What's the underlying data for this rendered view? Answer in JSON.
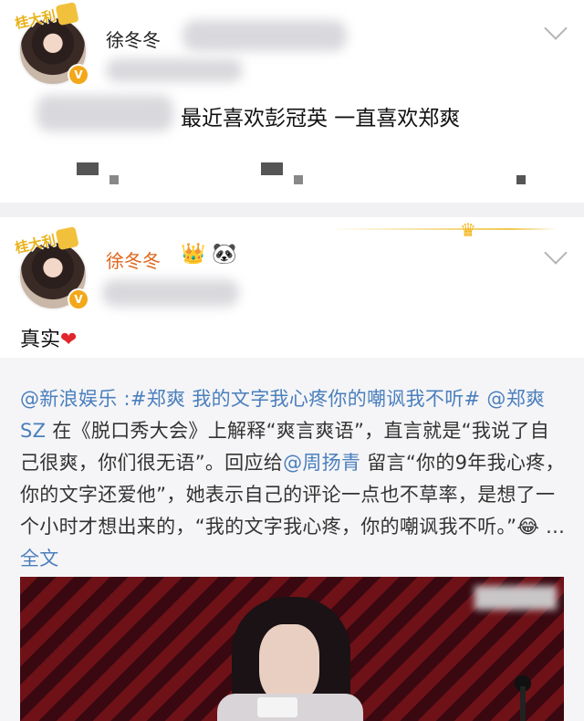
{
  "post1": {
    "username": "徐冬冬",
    "avatar_tag": "桂大利",
    "verified_glyph": "V",
    "content": "最近喜欢彭冠英 一直喜欢郑爽"
  },
  "post2": {
    "username": "徐冬冬",
    "crown_glyph": "👑",
    "panda_glyph": "🐼",
    "avatar_tag": "桂大利",
    "verified_glyph": "V",
    "content": "真实",
    "heart_glyph": "❤",
    "repost": {
      "mention_source": "@新浪娱乐",
      "sep": " :",
      "hashtag": "#郑爽 我的文字我心疼你的嘲讽我不听#",
      "space": " ",
      "mention_person": "@郑爽SZ",
      "text_1": " 在《脱口秀大会》上解释“爽言爽语”，直言就是“我说了自己很爽，你们很无语”。回应给",
      "mention_reply": "@周扬青",
      "text_2": " 留言“你的9年我心疼，你的文字还爱他”，她表示自己的评论一点也不草率，是想了一个小时才想出来的，“我的文字我心疼，你的嘲讽我不听。”",
      "emoji_glyph": "😂",
      "ellipsis": " ... ",
      "full_text_link": "全文"
    }
  }
}
